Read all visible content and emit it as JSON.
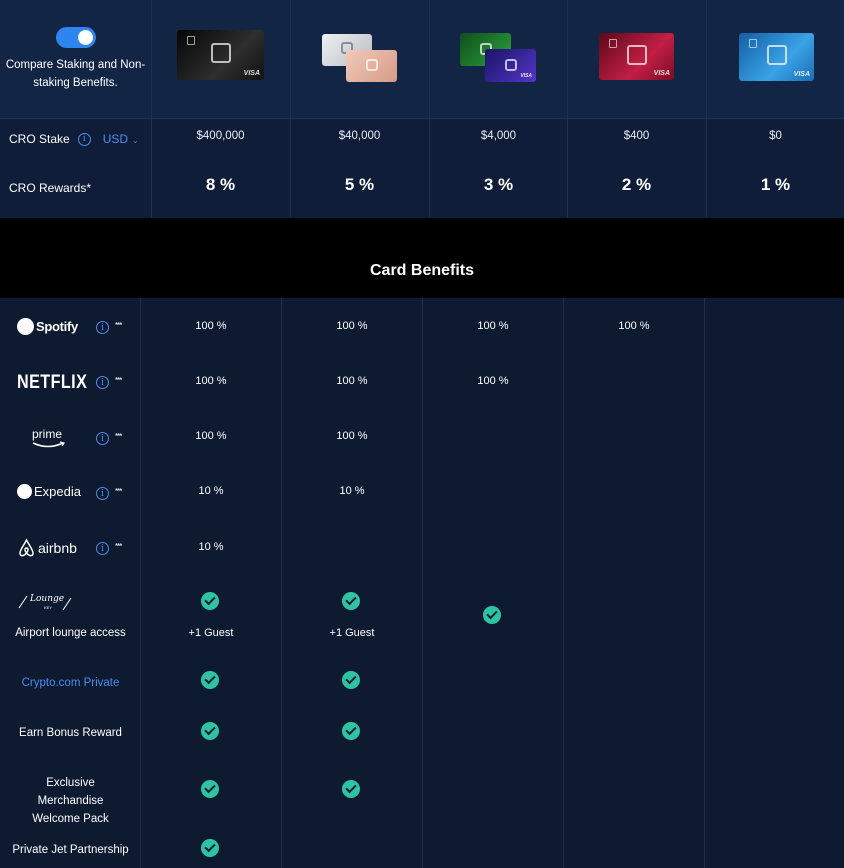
{
  "compare": {
    "toggle_on": true,
    "label": "Compare Staking and Non-staking Benefits."
  },
  "tiers": [
    {
      "card_style": "obsidian",
      "colors": [
        "#0e0e0e",
        "#2b2b2b"
      ],
      "stake": "$400,000",
      "reward": "8 %"
    },
    {
      "card_style": "frosted-rose-gold",
      "colors": [
        "#cfd3d8",
        "#e8b9a6"
      ],
      "stake": "$40,000",
      "reward": "5 %"
    },
    {
      "card_style": "jade-indigo",
      "colors": [
        "#1f7a2b",
        "#3b2a9a"
      ],
      "stake": "$4,000",
      "reward": "3 %"
    },
    {
      "card_style": "ruby-steel",
      "colors": [
        "#8a0f2a",
        "#c21f45"
      ],
      "stake": "$400",
      "reward": "2 %"
    },
    {
      "card_style": "midnight-blue",
      "colors": [
        "#1f6fb8",
        "#3a9fe0"
      ],
      "stake": "$0",
      "reward": "1 %"
    }
  ],
  "rows": {
    "stake_label": "CRO Stake",
    "currency": "USD",
    "rewards_label": "CRO Rewards*"
  },
  "section_title": "Card Benefits",
  "subscriptions": [
    {
      "brand": "Spotify",
      "icon": "spotify-icon",
      "values": [
        "100 %",
        "100 %",
        "100 %",
        "100 %",
        ""
      ]
    },
    {
      "brand": "NETFLIX",
      "icon": "netflix-wordmark",
      "values": [
        "100 %",
        "100 %",
        "100 %",
        "",
        ""
      ]
    },
    {
      "brand": "prime",
      "icon": "amazon-prime-icon",
      "values": [
        "100 %",
        "100 %",
        "",
        "",
        ""
      ]
    },
    {
      "brand": "Expedia",
      "icon": "expedia-icon",
      "values": [
        "10 %",
        "10 %",
        "",
        "",
        ""
      ]
    },
    {
      "brand": "airbnb",
      "icon": "airbnb-icon",
      "values": [
        "10 %",
        "",
        "",
        "",
        ""
      ]
    }
  ],
  "asterisks": "***",
  "lounge": {
    "logo_text": "Lounge",
    "logo_sub": "KEY",
    "label": "Airport lounge access",
    "guest_text": "+1 Guest"
  },
  "benefits": [
    {
      "label": "Crypto.com Private",
      "link": true
    },
    {
      "label": "Earn Bonus Reward",
      "link": false
    },
    {
      "label": "Exclusive Merchandise Welcome Pack",
      "link": false
    },
    {
      "label": "Private Jet Partnership",
      "link": false
    }
  ],
  "colors": {
    "accent": "#2f85f0",
    "check": "#2ec3a2",
    "band": "#000000"
  }
}
